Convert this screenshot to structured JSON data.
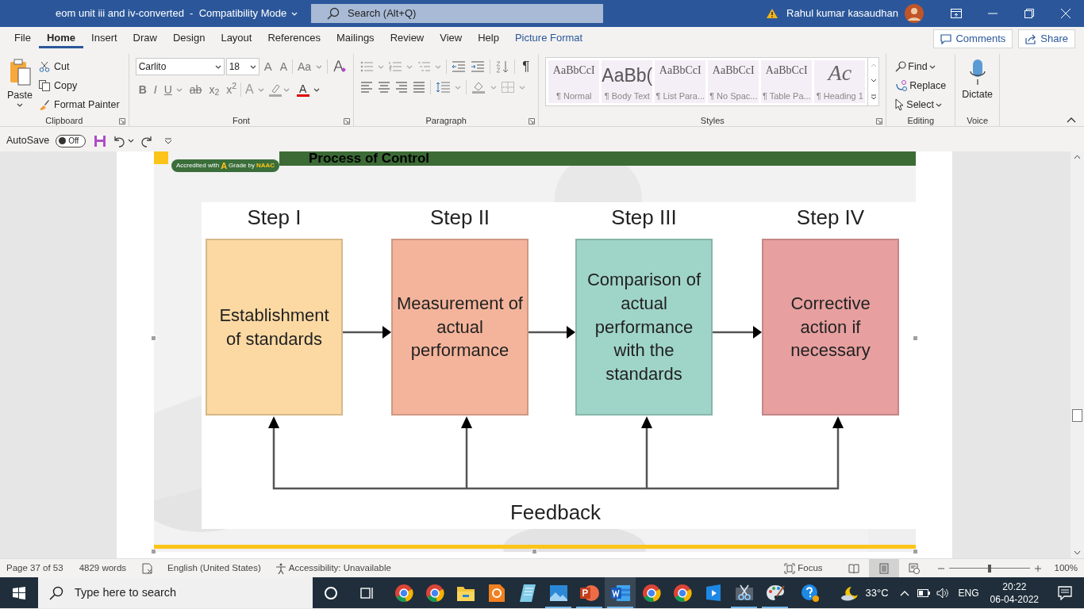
{
  "title_bar": {
    "document_title": "eom unit iii and iv-converted  -  Compatibility Mode",
    "search": "Search (Alt+Q)",
    "user": "Rahul kumar kasaudhan"
  },
  "tabs": [
    {
      "label": "File",
      "selected": false,
      "kind": "standard"
    },
    {
      "label": "Home",
      "selected": true,
      "kind": "standard"
    },
    {
      "label": "Insert",
      "selected": false,
      "kind": "standard"
    },
    {
      "label": "Draw",
      "selected": false,
      "kind": "standard"
    },
    {
      "label": "Design",
      "selected": false,
      "kind": "standard"
    },
    {
      "label": "Layout",
      "selected": false,
      "kind": "standard"
    },
    {
      "label": "References",
      "selected": false,
      "kind": "standard"
    },
    {
      "label": "Mailings",
      "selected": false,
      "kind": "standard"
    },
    {
      "label": "Review",
      "selected": false,
      "kind": "standard"
    },
    {
      "label": "View",
      "selected": false,
      "kind": "standard"
    },
    {
      "label": "Help",
      "selected": false,
      "kind": "standard"
    },
    {
      "label": "Picture Format",
      "selected": false,
      "kind": "contextual"
    }
  ],
  "header_buttons": {
    "comments": "Comments",
    "share": "Share"
  },
  "clipboard": {
    "paste": "Paste",
    "cut": "Cut",
    "copy": "Copy",
    "format_painter": "Format Painter",
    "label": "Clipboard"
  },
  "font": {
    "name": "Carlito",
    "size": "18",
    "grow": "A",
    "shrink": "A",
    "change_case": "Aa",
    "bold": "B",
    "italic": "I",
    "underline": "U",
    "strikethrough": "ab",
    "subscript": "x$_{2}$",
    "superscript": "x$^{2}$",
    "text_effects": "A",
    "font_color": "A",
    "label": "Font"
  },
  "paragraph": {
    "show_marks": "¶",
    "label": "Paragraph"
  },
  "styles": {
    "items": [
      {
        "preview": "AaBbCcI",
        "name": "¶ Normal",
        "kind": "serif"
      },
      {
        "preview": "AaBb(",
        "name": "¶ Body Text",
        "kind": "large"
      },
      {
        "preview": "AaBbCcI",
        "name": "¶ List Para...",
        "kind": "serif"
      },
      {
        "preview": "AaBbCcI",
        "name": "¶ No Spac...",
        "kind": "serif"
      },
      {
        "preview": "AaBbCcI",
        "name": "¶ Table Pa...",
        "kind": "serif"
      },
      {
        "preview": "Ac",
        "name": "¶ Heading 1",
        "kind": "heading"
      }
    ],
    "label": "Styles"
  },
  "editing": {
    "find": "Find",
    "replace": "Replace",
    "select": "Select",
    "label": "Editing"
  },
  "voice": {
    "dictate": "Dictate",
    "label": "Voice"
  },
  "quick_access": {
    "autosave": "AutoSave",
    "autosave_on": false,
    "toggle": "Off"
  },
  "document": {
    "slide_title": "Process of Control",
    "logo": {
      "accredited": "Accredited with",
      "grade": "A",
      "grade_by": "Grade by",
      "naac": "NAAC"
    },
    "steps": [
      {
        "heading": "Step I",
        "text": "Establishment of standards",
        "color": "#fcd9a2"
      },
      {
        "heading": "Step II",
        "text": "Measurement of actual performance",
        "color": "#f4b49b"
      },
      {
        "heading": "Step III",
        "text": "Comparison of actual performance with the standards",
        "color": "#9fd5c8"
      },
      {
        "heading": "Step IV",
        "text": "Corrective action if necessary",
        "color": "#e79f9f"
      }
    ],
    "feedback": "Feedback"
  },
  "status_bar": {
    "page": "Page 37 of 53",
    "words": "4829 words",
    "language": "English (United States)",
    "accessibility": "Accessibility: Unavailable",
    "focus": "Focus",
    "views": [
      {
        "kind": "read",
        "selected": false
      },
      {
        "kind": "print",
        "selected": true
      },
      {
        "kind": "web",
        "selected": false
      }
    ],
    "zoom": "100%",
    "zoom_slider": {
      "level": 0.5
    }
  },
  "taskbar": {
    "search_placeholder": "Type here to search",
    "apps": [
      {
        "kind": "browser",
        "running": false,
        "selected": false
      },
      {
        "kind": "browser",
        "running": false,
        "selected": false
      },
      {
        "kind": "folder",
        "running": false,
        "selected": false
      },
      {
        "kind": "pdf",
        "running": false,
        "selected": false
      },
      {
        "kind": "notepad",
        "running": false,
        "selected": false
      },
      {
        "kind": "photos",
        "running": true,
        "selected": false
      },
      {
        "kind": "slides",
        "running": true,
        "selected": false
      },
      {
        "kind": "word",
        "running": true,
        "selected": true
      },
      {
        "kind": "browser",
        "running": false,
        "selected": false
      },
      {
        "kind": "browser",
        "running": false,
        "selected": false
      },
      {
        "kind": "video",
        "running": false,
        "selected": false
      },
      {
        "kind": "scissors",
        "running": true,
        "selected": false
      },
      {
        "kind": "paint",
        "running": true,
        "selected": false
      },
      {
        "kind": "help",
        "running": false,
        "selected": false
      }
    ],
    "temperature": "33°C",
    "language": "ENG",
    "time": "20:22",
    "date": "06-04-2022"
  }
}
